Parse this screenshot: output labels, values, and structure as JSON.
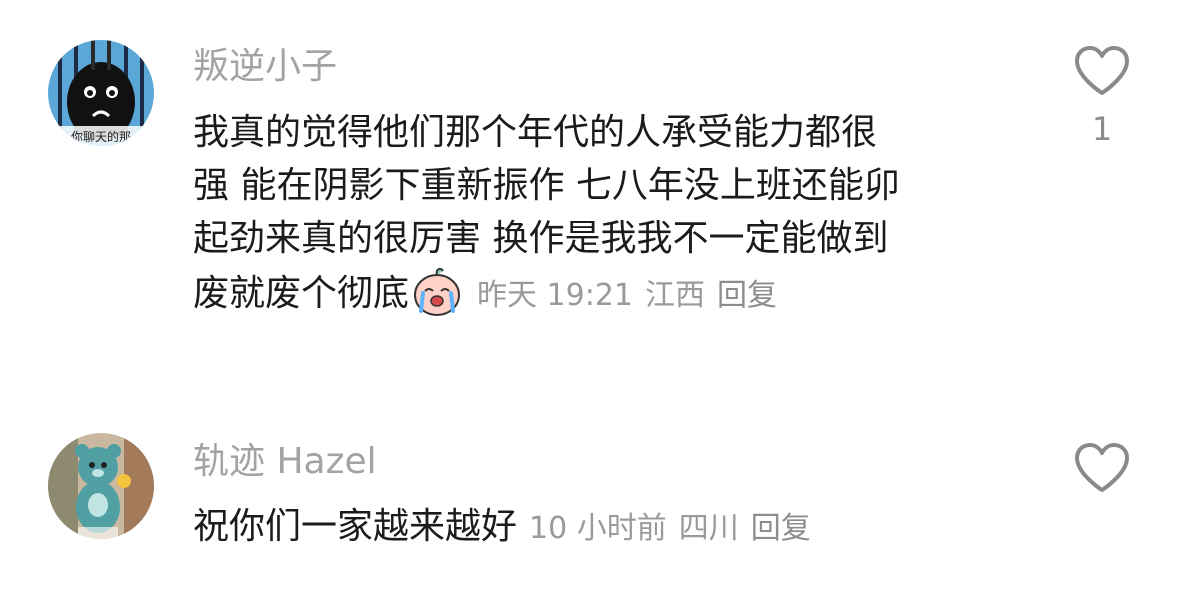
{
  "comments": [
    {
      "username": "叛逆小子",
      "lines": [
        "我真的觉得他们那个年代的人承受能力都很",
        "强 能在阴影下重新振作 七八年没上班还能卯",
        "起劲来真的很厉害 换作是我我不一定能做到",
        "废就废个彻底"
      ],
      "emoji": "crying-emoji",
      "time": "昨天 19:21",
      "location": "江西",
      "reply_label": "回复",
      "like_count": "1",
      "avatar_text": "你聊天的那"
    },
    {
      "username": "轨迹 Hazel",
      "lines": [
        "祝你们一家越来越好"
      ],
      "time": "10 小时前",
      "location": "四川",
      "reply_label": "回复",
      "like_count": ""
    }
  ],
  "icons": {
    "like": "heart-outline-icon"
  },
  "colors": {
    "username": "#a3a3a3",
    "text": "#1b1b1b",
    "meta": "#9a9a9a"
  }
}
